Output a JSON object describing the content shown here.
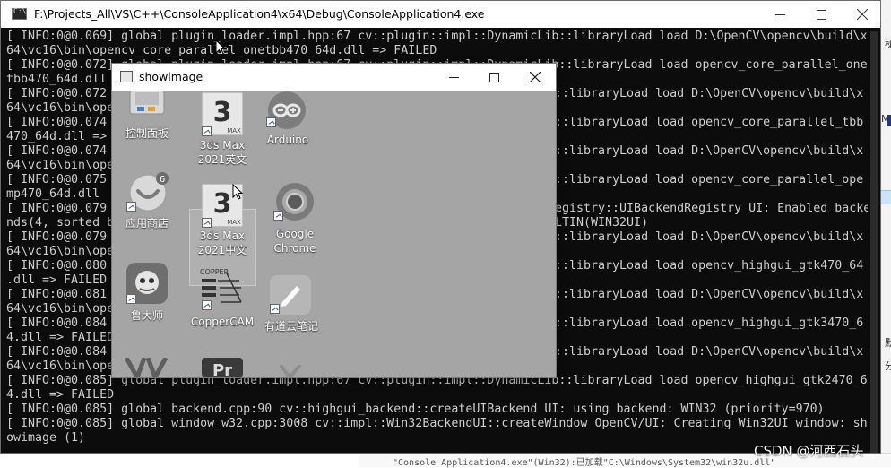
{
  "console": {
    "title": "F:\\Projects_All\\VS\\C++\\ConsoleApplication4\\x64\\Debug\\ConsoleApplication4.exe",
    "icon": "console-app-icon",
    "lines": [
      {
        "x": 0,
        "text": "[ INFO:0@0.069] global plugin_loader.impl.hpp:67 cv::plugin::impl::DynamicLib::libraryLoad load D:\\OpenCV\\opencv\\build\\x"
      },
      {
        "x": 0,
        "text": "64\\vc16\\bin\\opencv_core_parallel_onetbb470_64d.dll => FAILED"
      },
      {
        "x": 0,
        "text": "[ INFO:0@0.072] global plugin_loader.impl.hpp:67 cv::plugin::impl::DynamicLib::libraryLoad load opencv_core_parallel_one"
      },
      {
        "x": 0,
        "text": "tbb470_64d.dll"
      },
      {
        "x": 0,
        "text": "[ INFO:0@0.072"
      },
      {
        "x": 0,
        "text": "64\\vc16\\bin\\ope"
      },
      {
        "x": 0,
        "text": "[ INFO:0@0.074"
      },
      {
        "x": 0,
        "text": "470_64d.dll =>"
      },
      {
        "x": 0,
        "text": "[ INFO:0@0.074"
      },
      {
        "x": 0,
        "text": "64\\vc16\\bin\\ope"
      },
      {
        "x": 0,
        "text": "[ INFO:0@0.075"
      },
      {
        "x": 0,
        "text": "mp470_64d.dll"
      },
      {
        "x": 0,
        "text": "[ INFO:0@0.079"
      },
      {
        "x": 0,
        "text": "nds(4, sorted b"
      },
      {
        "x": 0,
        "text": "[ INFO:0@0.079"
      },
      {
        "x": 0,
        "text": "64\\vc16\\bin\\ope"
      },
      {
        "x": 0,
        "text": "[ INFO:0@0.080"
      },
      {
        "x": 0,
        "text": ".dll => FAILED"
      },
      {
        "x": 0,
        "text": "[ INFO:0@0.081"
      },
      {
        "x": 0,
        "text": "64\\vc16\\bin\\ope"
      },
      {
        "x": 0,
        "text": "[ INFO:0@0.084"
      },
      {
        "x": 0,
        "text": "4.dll => FAILED"
      },
      {
        "x": 0,
        "text": "[ INFO:0@0.084"
      },
      {
        "x": 0,
        "text": "64\\vc16\\bin\\ope"
      },
      {
        "x": 0,
        "text": "[ INFO:0@0.085] global plugin_loader.impl.hpp:67 cv::plugin::impl::DynamicLib::libraryLoad load opencv_highgui_gtk2470_6"
      },
      {
        "x": 0,
        "text": "4.dll => FAILED"
      },
      {
        "x": 0,
        "text": "[ INFO:0@0.085] global backend.cpp:90 cv::highgui_backend::createUIBackend UI: using backend: WIN32 (priority=970)"
      },
      {
        "x": 0,
        "text": "[ INFO:0@0.085] global window_w32.cpp:3008 cv::impl::Win32BackendUI::createWindow OpenCV/UI: Creating Win32UI window: sh"
      },
      {
        "x": 0,
        "text": "owimage (1)"
      }
    ],
    "right_fragments": [
      {
        "row": 4,
        "text": "::libraryLoad load D:\\OpenCV\\opencv\\build\\x"
      },
      {
        "row": 6,
        "text": "::libraryLoad load opencv_core_parallel_tbb"
      },
      {
        "row": 8,
        "text": "::libraryLoad load D:\\OpenCV\\opencv\\build\\x"
      },
      {
        "row": 10,
        "text": "::libraryLoad load opencv_core_parallel_ope"
      },
      {
        "row": 12,
        "text": "egistry::UIBackendRegistry UI: Enabled backe"
      },
      {
        "row": 13,
        "text": "LTIN(WIN32UI)"
      },
      {
        "row": 14,
        "text": "::libraryLoad load D:\\OpenCV\\opencv\\build\\x"
      },
      {
        "row": 16,
        "text": "::libraryLoad load opencv_highgui_gtk470_64"
      },
      {
        "row": 18,
        "text": "::libraryLoad load D:\\OpenCV\\opencv\\build\\x"
      },
      {
        "row": 20,
        "text": "::libraryLoad load opencv_highgui_gtk3470_6"
      },
      {
        "row": 22,
        "text": "::libraryLoad load D:\\OpenCV\\opencv\\build\\x"
      }
    ]
  },
  "showimage": {
    "title": "showimage",
    "icons": [
      {
        "name": "control-panel",
        "label": "控制面板",
        "label2": ""
      },
      {
        "name": "3ds-max-2021-en",
        "label": "3ds Max",
        "label2": "2021英文"
      },
      {
        "name": "arduino",
        "label": "Arduino",
        "label2": ""
      },
      {
        "name": "app-store",
        "label": "应用商店",
        "label2": "",
        "badge": "6"
      },
      {
        "name": "3ds-max-2021-cn",
        "label": "3ds Max",
        "label2": "2021中文"
      },
      {
        "name": "google-chrome",
        "label": "Google",
        "label2": "Chrome"
      },
      {
        "name": "ludashi",
        "label": "鲁大师",
        "label2": ""
      },
      {
        "name": "coppercam",
        "label": "CopperCAM",
        "label2": "",
        "logo_text": "COPPER"
      },
      {
        "name": "youdao-note",
        "label": "有道云笔记",
        "label2": ""
      }
    ],
    "max_logo_number": "3",
    "max_logo_word": "MAX",
    "pr_text": "Pr"
  },
  "background": {
    "right_texts": [
      "秘",
      "M",
      "分",
      "默"
    ],
    "bottom_text": "\"Console Application4.exe\"(Win32):已加载\"C:\\Windows\\System32\\win32u.dll\""
  },
  "watermark": "CSDN @河西石头",
  "colors": {
    "console_bg": "#0c0c0c",
    "console_text": "#cccccc",
    "desktop_gray": "#a5a5a5"
  }
}
